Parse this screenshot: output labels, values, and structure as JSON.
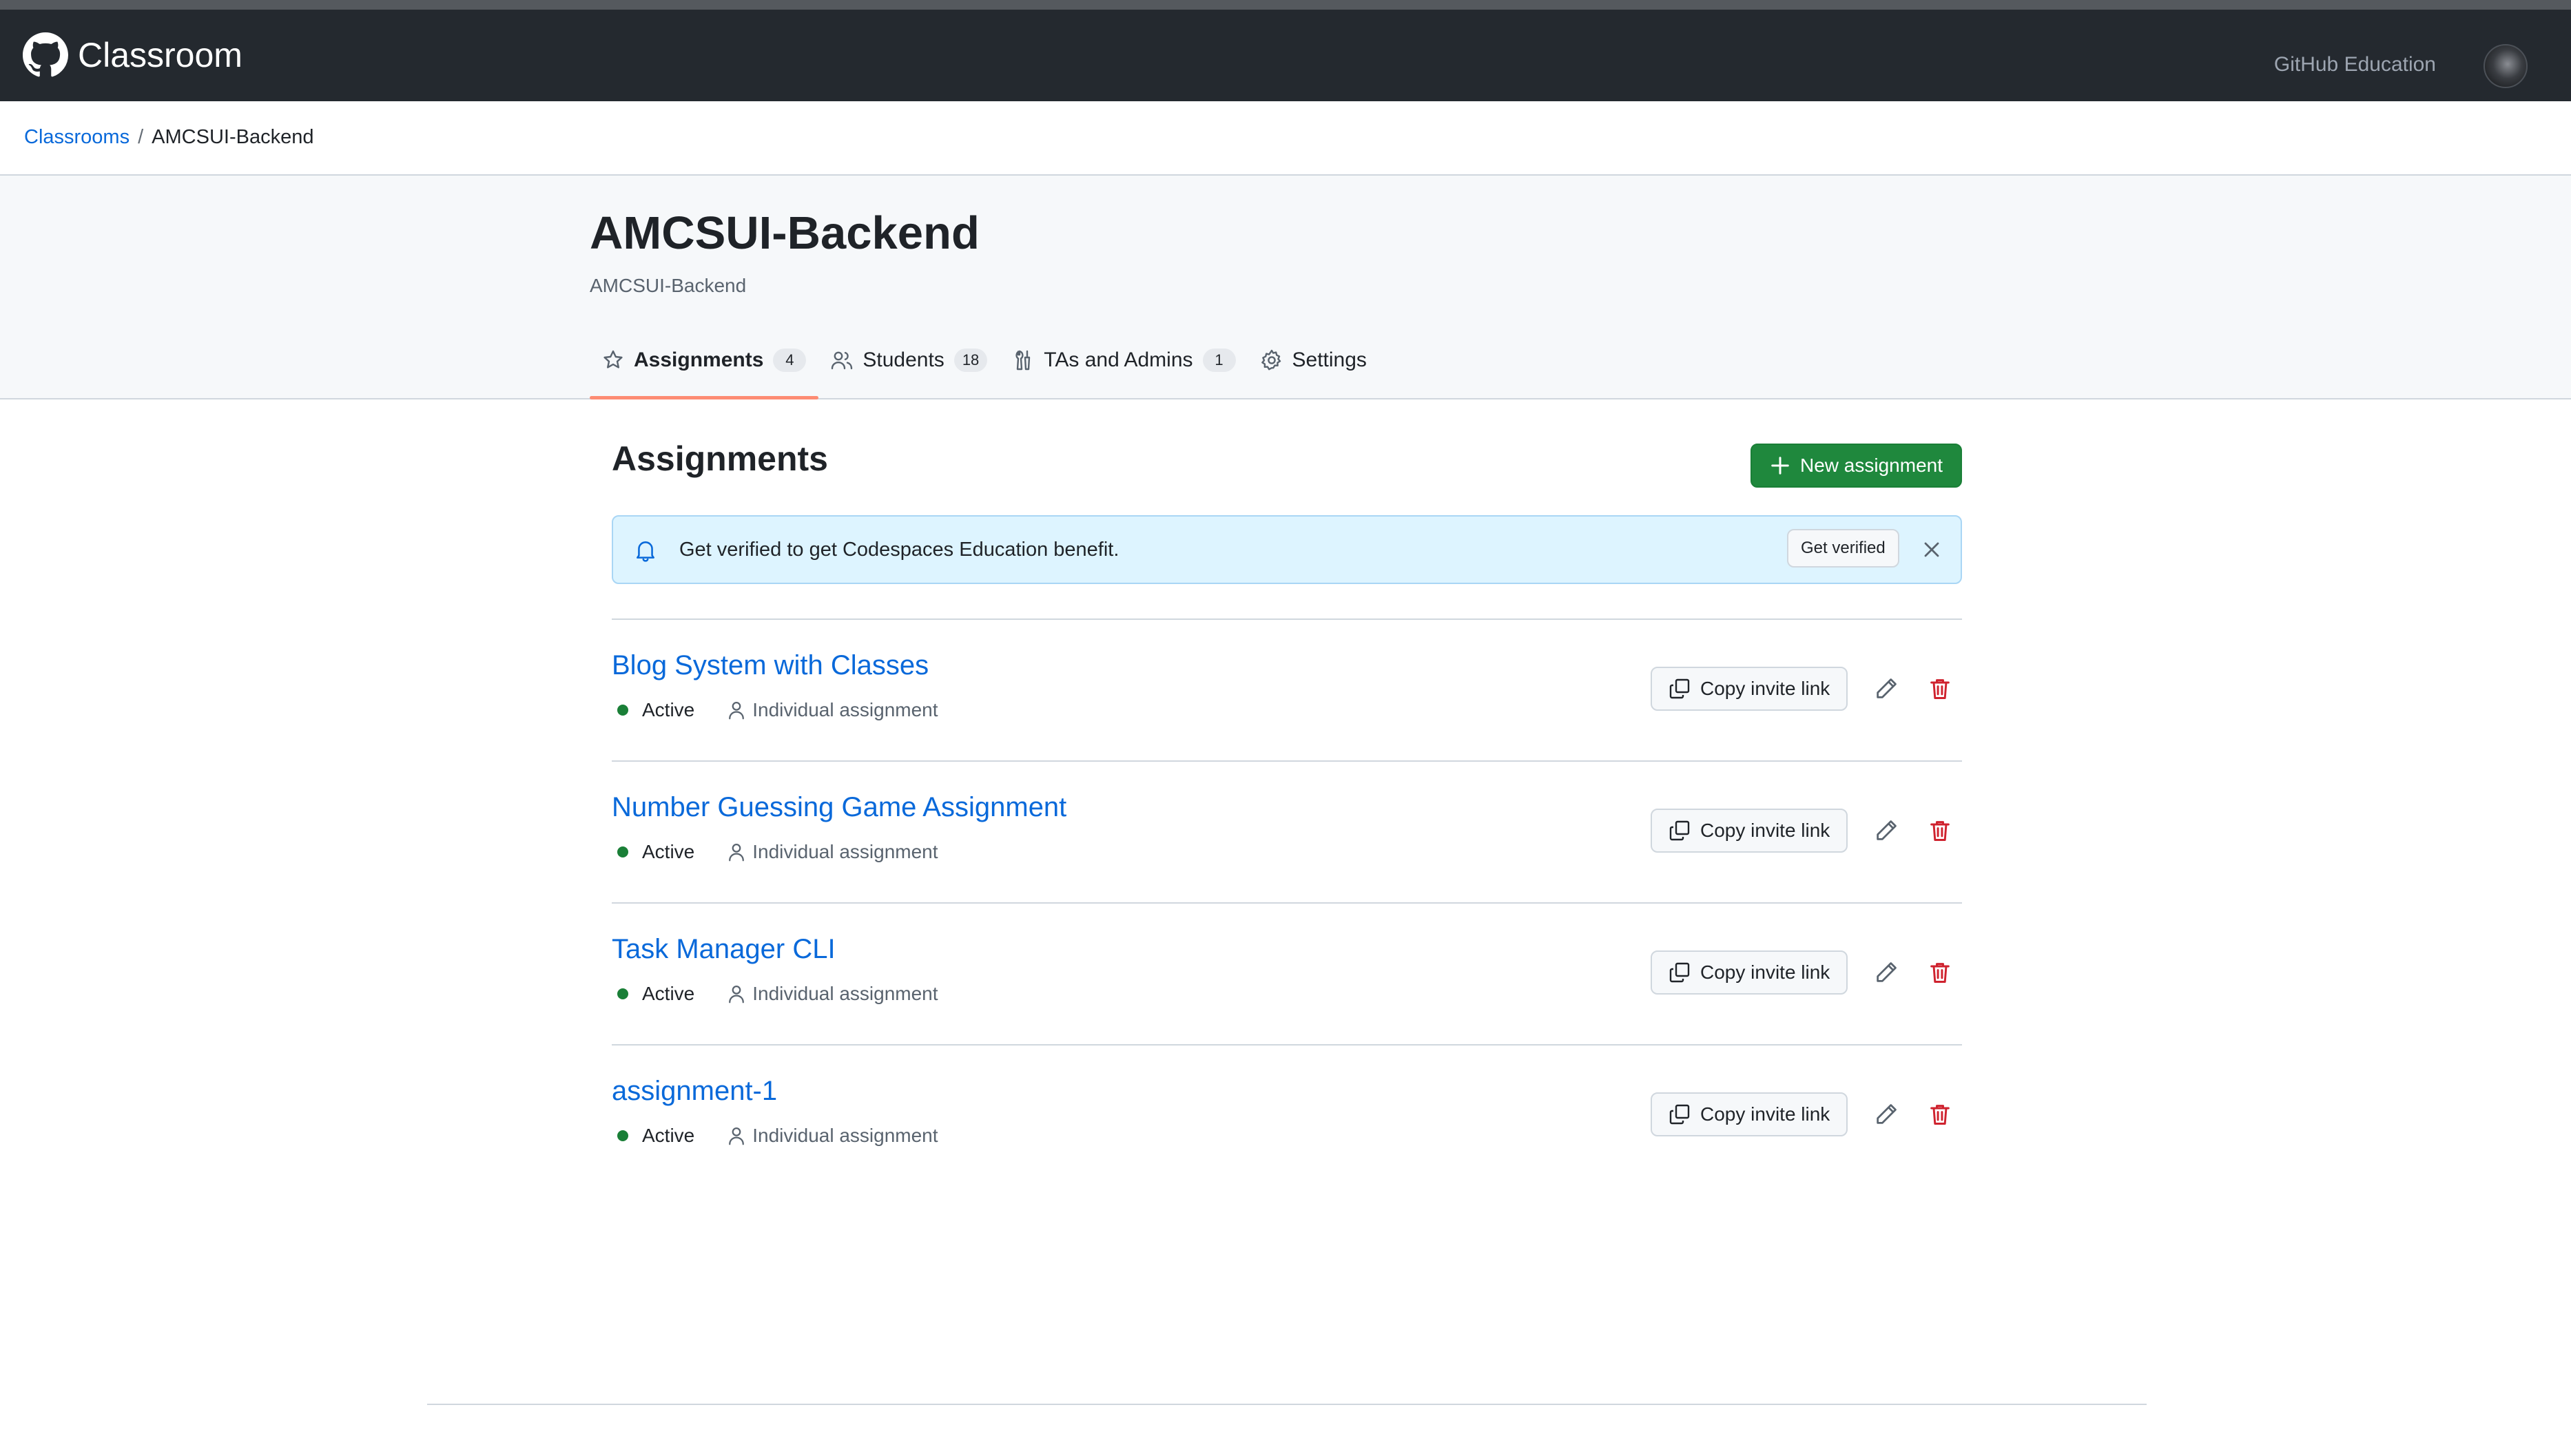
{
  "header": {
    "brand": "Classroom",
    "edu_link": "GitHub Education"
  },
  "breadcrumb": {
    "root": "Classrooms",
    "separator": "/",
    "current": "AMCSUI-Backend"
  },
  "classroom": {
    "title": "AMCSUI-Backend",
    "subtitle": "AMCSUI-Backend"
  },
  "tabs": [
    {
      "label": "Assignments",
      "count": "4",
      "icon": "star-icon",
      "active": true
    },
    {
      "label": "Students",
      "count": "18",
      "icon": "people-icon"
    },
    {
      "label": "TAs and Admins",
      "count": "1",
      "icon": "tools-icon"
    },
    {
      "label": "Settings",
      "icon": "gear-icon"
    }
  ],
  "assignments_section": {
    "heading": "Assignments",
    "new_button": "New assignment"
  },
  "banner": {
    "message": "Get verified to get Codespaces Education benefit.",
    "action": "Get verified"
  },
  "assignments": [
    {
      "title": "Blog System with Classes",
      "status": "Active",
      "type": "Individual assignment",
      "copy_label": "Copy invite link"
    },
    {
      "title": "Number Guessing Game Assignment",
      "status": "Active",
      "type": "Individual assignment",
      "copy_label": "Copy invite link"
    },
    {
      "title": "Task Manager CLI",
      "status": "Active",
      "type": "Individual assignment",
      "copy_label": "Copy invite link"
    },
    {
      "title": "assignment-1",
      "status": "Active",
      "type": "Individual assignment",
      "copy_label": "Copy invite link"
    }
  ],
  "colors": {
    "header_bg": "#24292f",
    "link": "#0969da",
    "primary_button": "#1f883d",
    "status_active": "#1a7f37",
    "danger": "#cf222e",
    "tab_underline": "#fd8c73",
    "banner_bg": "#ddf4ff"
  }
}
